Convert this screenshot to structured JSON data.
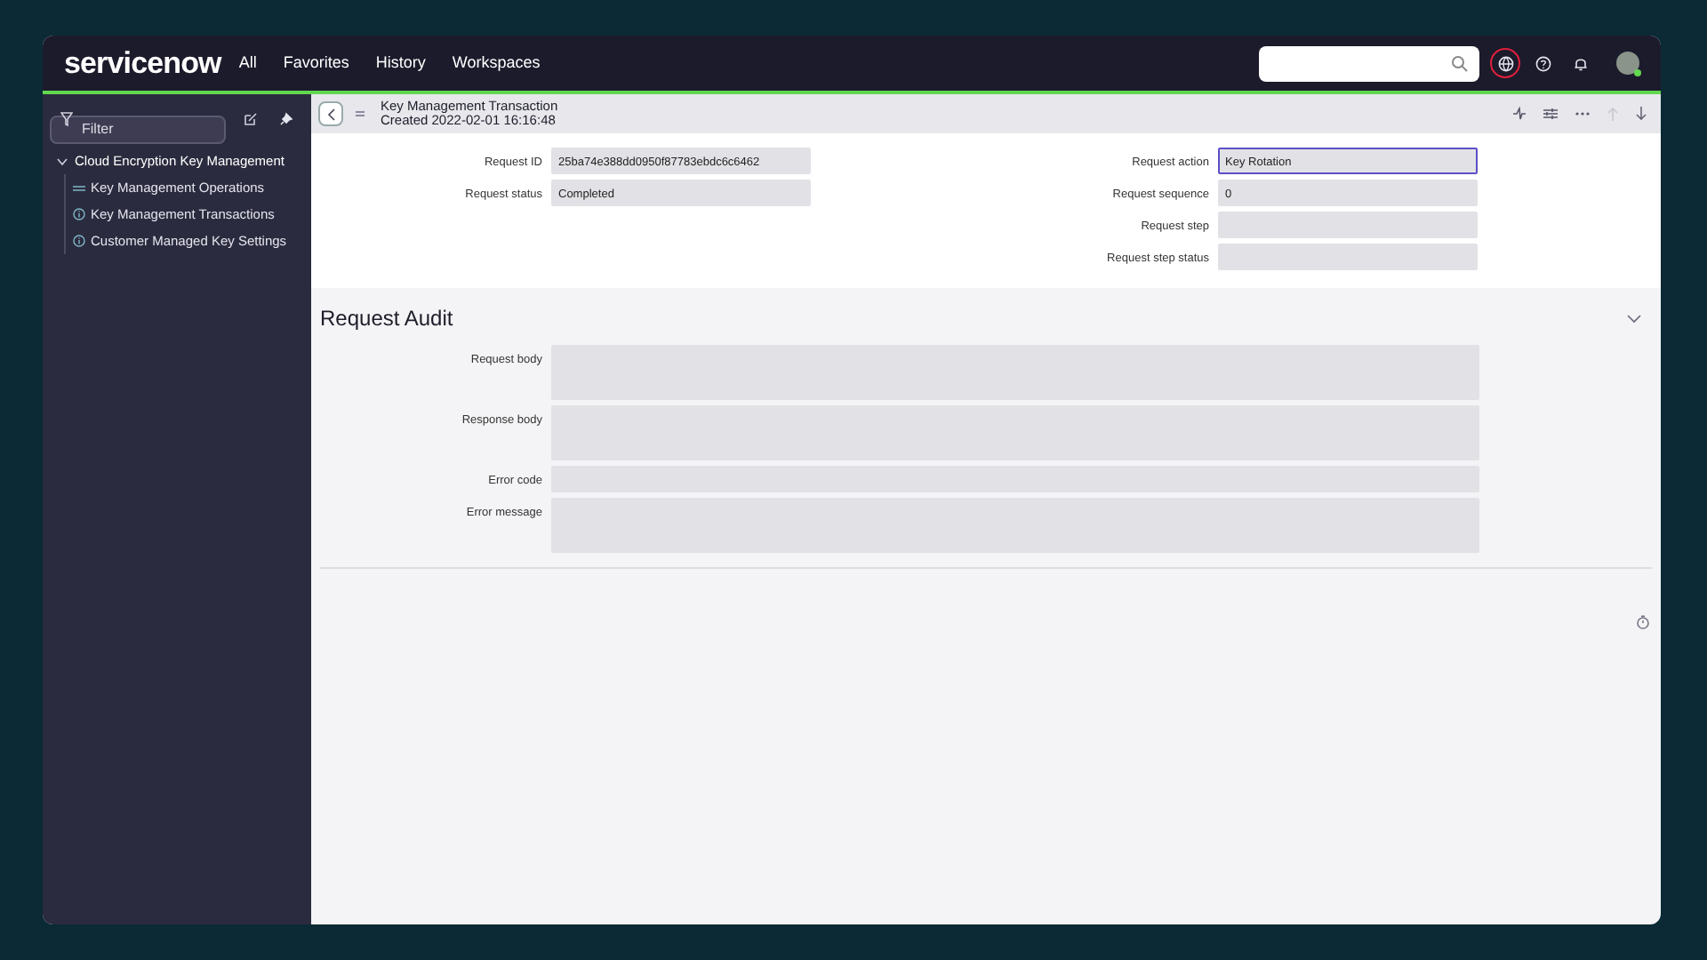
{
  "header": {
    "logo": "servicenow",
    "nav": [
      "All",
      "Favorites",
      "History",
      "Workspaces"
    ],
    "icons": [
      {
        "kind": "globe",
        "highlighted": true
      },
      {
        "kind": "help",
        "highlighted": false
      },
      {
        "kind": "bell",
        "highlighted": false
      }
    ]
  },
  "sidebar": {
    "filter_placeholder": "Filter",
    "tree": [
      {
        "label": "Cloud Encryption Key Management",
        "expanded": true,
        "children": [
          {
            "label": "Key Management Operations",
            "kind": "list"
          },
          {
            "label": "Key Management Transactions",
            "kind": "info"
          },
          {
            "label": "Customer Managed Key Settings",
            "kind": "info"
          }
        ]
      }
    ]
  },
  "form": {
    "title": "Key Management Transaction",
    "subtitle": "Created 2022-02-01 16:16:48",
    "left_fields": [
      {
        "label": "Request ID",
        "value": "25ba74e388dd0950f87783ebdc6c6462",
        "focused": false
      },
      {
        "label": "Request status",
        "value": "Completed",
        "focused": false
      }
    ],
    "right_fields": [
      {
        "label": "Request action",
        "value": "Key Rotation",
        "focused": true
      },
      {
        "label": "Request sequence",
        "value": "0",
        "focused": false
      },
      {
        "label": "Request step",
        "focused": false
      },
      {
        "label": "Request step status",
        "focused": false
      }
    ],
    "section": {
      "title": "Request Audit",
      "expanded": true,
      "fields": [
        {
          "label": "Request body",
          "kind": "multiline"
        },
        {
          "label": "Response body",
          "kind": "multiline"
        },
        {
          "label": "Error code",
          "kind": "single"
        },
        {
          "label": "Error message",
          "kind": "multiline"
        }
      ]
    }
  }
}
